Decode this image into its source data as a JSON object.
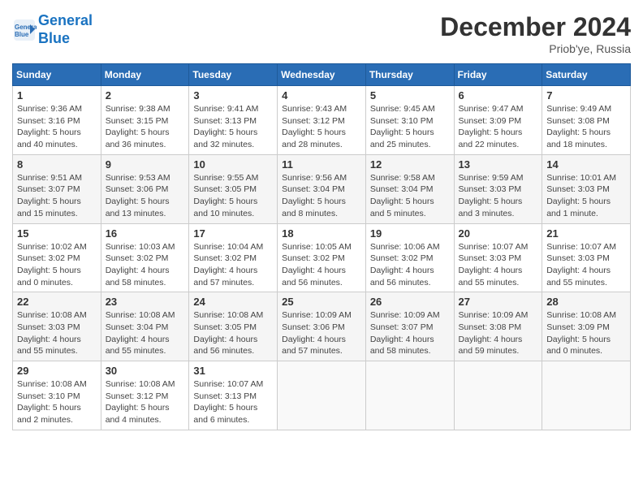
{
  "header": {
    "logo_line1": "General",
    "logo_line2": "Blue",
    "month_title": "December 2024",
    "location": "Priob'ye, Russia"
  },
  "days_of_week": [
    "Sunday",
    "Monday",
    "Tuesday",
    "Wednesday",
    "Thursday",
    "Friday",
    "Saturday"
  ],
  "weeks": [
    [
      {
        "day": "1",
        "info": "Sunrise: 9:36 AM\nSunset: 3:16 PM\nDaylight: 5 hours\nand 40 minutes."
      },
      {
        "day": "2",
        "info": "Sunrise: 9:38 AM\nSunset: 3:15 PM\nDaylight: 5 hours\nand 36 minutes."
      },
      {
        "day": "3",
        "info": "Sunrise: 9:41 AM\nSunset: 3:13 PM\nDaylight: 5 hours\nand 32 minutes."
      },
      {
        "day": "4",
        "info": "Sunrise: 9:43 AM\nSunset: 3:12 PM\nDaylight: 5 hours\nand 28 minutes."
      },
      {
        "day": "5",
        "info": "Sunrise: 9:45 AM\nSunset: 3:10 PM\nDaylight: 5 hours\nand 25 minutes."
      },
      {
        "day": "6",
        "info": "Sunrise: 9:47 AM\nSunset: 3:09 PM\nDaylight: 5 hours\nand 22 minutes."
      },
      {
        "day": "7",
        "info": "Sunrise: 9:49 AM\nSunset: 3:08 PM\nDaylight: 5 hours\nand 18 minutes."
      }
    ],
    [
      {
        "day": "8",
        "info": "Sunrise: 9:51 AM\nSunset: 3:07 PM\nDaylight: 5 hours\nand 15 minutes."
      },
      {
        "day": "9",
        "info": "Sunrise: 9:53 AM\nSunset: 3:06 PM\nDaylight: 5 hours\nand 13 minutes."
      },
      {
        "day": "10",
        "info": "Sunrise: 9:55 AM\nSunset: 3:05 PM\nDaylight: 5 hours\nand 10 minutes."
      },
      {
        "day": "11",
        "info": "Sunrise: 9:56 AM\nSunset: 3:04 PM\nDaylight: 5 hours\nand 8 minutes."
      },
      {
        "day": "12",
        "info": "Sunrise: 9:58 AM\nSunset: 3:04 PM\nDaylight: 5 hours\nand 5 minutes."
      },
      {
        "day": "13",
        "info": "Sunrise: 9:59 AM\nSunset: 3:03 PM\nDaylight: 5 hours\nand 3 minutes."
      },
      {
        "day": "14",
        "info": "Sunrise: 10:01 AM\nSunset: 3:03 PM\nDaylight: 5 hours\nand 1 minute."
      }
    ],
    [
      {
        "day": "15",
        "info": "Sunrise: 10:02 AM\nSunset: 3:02 PM\nDaylight: 5 hours\nand 0 minutes."
      },
      {
        "day": "16",
        "info": "Sunrise: 10:03 AM\nSunset: 3:02 PM\nDaylight: 4 hours\nand 58 minutes."
      },
      {
        "day": "17",
        "info": "Sunrise: 10:04 AM\nSunset: 3:02 PM\nDaylight: 4 hours\nand 57 minutes."
      },
      {
        "day": "18",
        "info": "Sunrise: 10:05 AM\nSunset: 3:02 PM\nDaylight: 4 hours\nand 56 minutes."
      },
      {
        "day": "19",
        "info": "Sunrise: 10:06 AM\nSunset: 3:02 PM\nDaylight: 4 hours\nand 56 minutes."
      },
      {
        "day": "20",
        "info": "Sunrise: 10:07 AM\nSunset: 3:03 PM\nDaylight: 4 hours\nand 55 minutes."
      },
      {
        "day": "21",
        "info": "Sunrise: 10:07 AM\nSunset: 3:03 PM\nDaylight: 4 hours\nand 55 minutes."
      }
    ],
    [
      {
        "day": "22",
        "info": "Sunrise: 10:08 AM\nSunset: 3:03 PM\nDaylight: 4 hours\nand 55 minutes."
      },
      {
        "day": "23",
        "info": "Sunrise: 10:08 AM\nSunset: 3:04 PM\nDaylight: 4 hours\nand 55 minutes."
      },
      {
        "day": "24",
        "info": "Sunrise: 10:08 AM\nSunset: 3:05 PM\nDaylight: 4 hours\nand 56 minutes."
      },
      {
        "day": "25",
        "info": "Sunrise: 10:09 AM\nSunset: 3:06 PM\nDaylight: 4 hours\nand 57 minutes."
      },
      {
        "day": "26",
        "info": "Sunrise: 10:09 AM\nSunset: 3:07 PM\nDaylight: 4 hours\nand 58 minutes."
      },
      {
        "day": "27",
        "info": "Sunrise: 10:09 AM\nSunset: 3:08 PM\nDaylight: 4 hours\nand 59 minutes."
      },
      {
        "day": "28",
        "info": "Sunrise: 10:08 AM\nSunset: 3:09 PM\nDaylight: 5 hours\nand 0 minutes."
      }
    ],
    [
      {
        "day": "29",
        "info": "Sunrise: 10:08 AM\nSunset: 3:10 PM\nDaylight: 5 hours\nand 2 minutes."
      },
      {
        "day": "30",
        "info": "Sunrise: 10:08 AM\nSunset: 3:12 PM\nDaylight: 5 hours\nand 4 minutes."
      },
      {
        "day": "31",
        "info": "Sunrise: 10:07 AM\nSunset: 3:13 PM\nDaylight: 5 hours\nand 6 minutes."
      },
      {
        "day": "",
        "info": ""
      },
      {
        "day": "",
        "info": ""
      },
      {
        "day": "",
        "info": ""
      },
      {
        "day": "",
        "info": ""
      }
    ]
  ]
}
